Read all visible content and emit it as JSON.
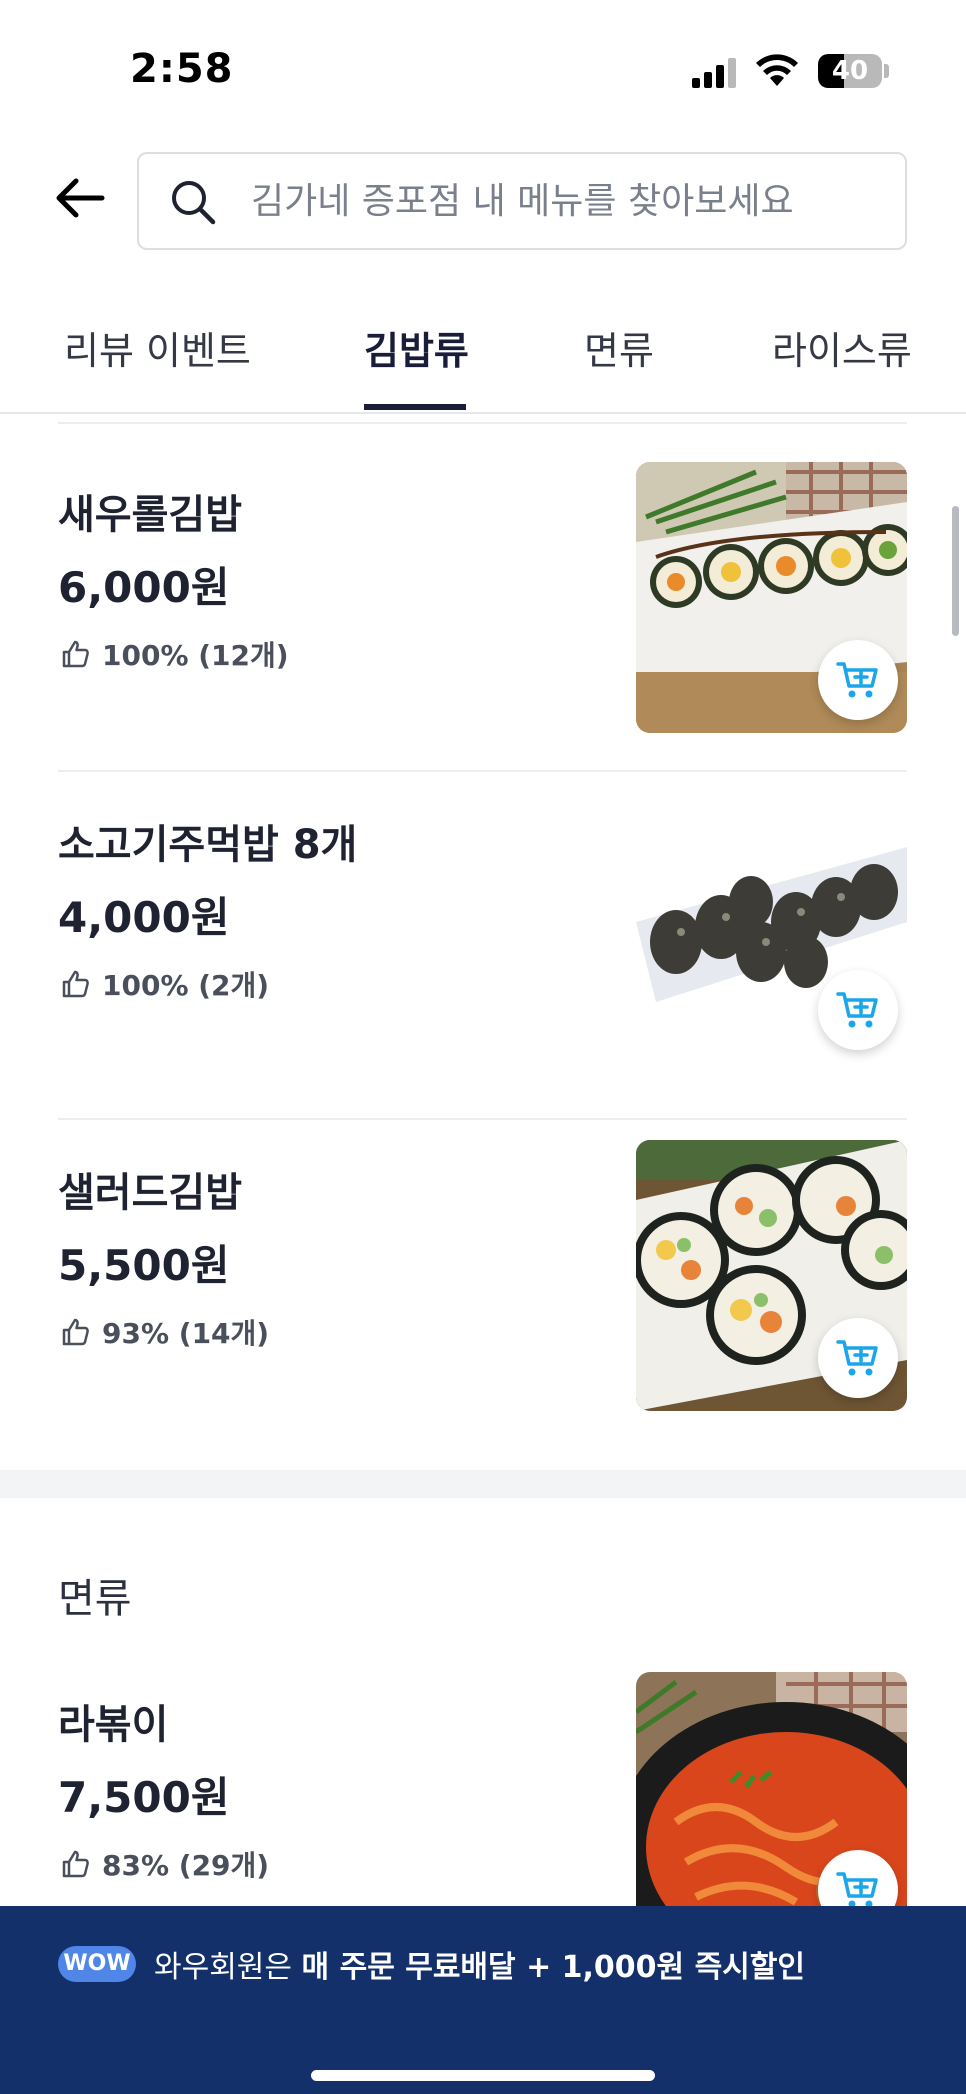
{
  "status_bar": {
    "time": "2:58",
    "battery": "40",
    "battery_level": 0.4
  },
  "search": {
    "placeholder": "김가네 증포점 내 메뉴를 찾아보세요"
  },
  "tabs": [
    {
      "label": "리뷰 이벤트"
    },
    {
      "label": "김밥류",
      "active": true
    },
    {
      "label": "면류"
    },
    {
      "label": "라이스류"
    }
  ],
  "items": [
    {
      "name": "새우롤김밥",
      "price": "6,000원",
      "rating": "100% (12개)"
    },
    {
      "name": "소고기주먹밥 8개",
      "price": "4,000원",
      "rating": "100% (2개)"
    },
    {
      "name": "샐러드김밥",
      "price": "5,500원",
      "rating": "93% (14개)"
    },
    {
      "name": "라볶이",
      "price": "7,500원",
      "rating": "83% (29개)"
    }
  ],
  "section": {
    "title": "면류"
  },
  "banner": {
    "badge": "WOW",
    "prefix": "와우회원은 ",
    "highlight": "매 주문 무료배달 + 1,000원 즉시할인"
  },
  "colors": {
    "accent": "#1a1d3a",
    "banner_bg": "#13306a",
    "cart_icon": "#1aa6ea"
  }
}
